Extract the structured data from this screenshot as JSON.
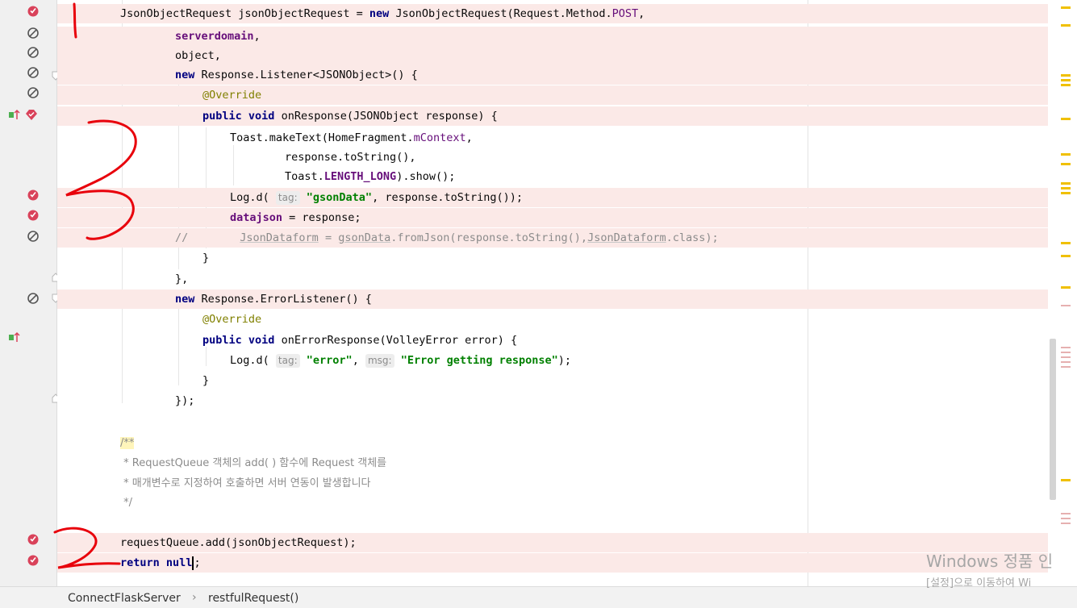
{
  "editor": {
    "lines": {
      "l1": {
        "a": "JsonObjectRequest jsonObjectRequest = ",
        "kw": "new",
        "b": " JsonObjectRequest(Request.Method.",
        "fld": "POST",
        "c": ","
      },
      "l2": {
        "fld": "serverdomain",
        "c": ","
      },
      "l3": {
        "a": "object,"
      },
      "l4": {
        "kw": "new",
        "b": " Response.Listener<JSONObject>() {"
      },
      "l5": {
        "ann": "@Override"
      },
      "l6": {
        "kw1": "public",
        "kw2": "void",
        "b": " onResponse(JSONObject response) {"
      },
      "l7": {
        "a": "Toast.makeText(HomeFragment.",
        "fld": "mContext",
        "c": ","
      },
      "l8": {
        "a": "response.toString(),"
      },
      "l9": {
        "a": "Toast.",
        "fld": "LENGTH_LONG",
        "c": ").show();"
      },
      "l10": {
        "a": "Log.d(",
        "hint": "tag:",
        "str": "\"gsonData\"",
        "c": ", response.toString());"
      },
      "l11": {
        "fld": "datajson",
        "c": " = response;"
      },
      "l12": {
        "cmt_slash": "//",
        "cmt1": "JsonDataform",
        "cmt2": " = ",
        "cmt3": "gsonData",
        "cmt4": ".fromJson(response.toString(),",
        "cmt5": "JsonDataform",
        "cmt6": ".class);"
      },
      "l13": {
        "a": "}"
      },
      "l14": {
        "a": "},"
      },
      "l15": {
        "kw": "new",
        "b": " Response.ErrorListener() {"
      },
      "l16": {
        "ann": "@Override"
      },
      "l17": {
        "kw1": "public",
        "kw2": "void",
        "b": " onErrorResponse(VolleyError error) {"
      },
      "l18": {
        "a": "Log.d(",
        "hint1": "tag:",
        "str1": "\"error\"",
        "sep": ", ",
        "hint2": "msg:",
        "str2": "\"Error getting response\"",
        "c": ");"
      },
      "l19": {
        "a": "}"
      },
      "l20": {
        "a": "});"
      },
      "l22": {
        "doc": "/**"
      },
      "l23": {
        "doc": " * RequestQueue 객체의 add( ) 함수에 Request 객체를"
      },
      "l24": {
        "doc": " * 매개변수로 지정하여 호출하면 서버 연동이 발생합니다"
      },
      "l25": {
        "doc": " */"
      },
      "l27": {
        "a": "requestQueue.add(jsonObjectRequest);"
      },
      "l28": {
        "kw": "return",
        "sp": " ",
        "kw2": "null",
        "c": ";"
      }
    }
  },
  "breadcrumb": {
    "file": "ConnectFlaskServer",
    "separator": "›",
    "method": "restfulRequest()"
  },
  "watermark": {
    "line1": "Windows 정품 인",
    "line2": "[설정]으로 이동하여 Wi"
  },
  "colors": {
    "breakpoint_line": "#fbe9e7",
    "annotation_ink": "#e8000b",
    "keyword": "#000080",
    "field": "#660e7a",
    "string": "#008000"
  }
}
